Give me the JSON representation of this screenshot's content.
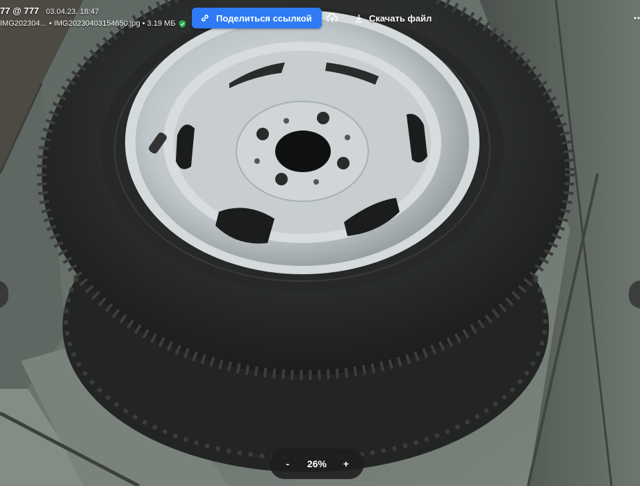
{
  "header": {
    "title": "77 @ 777",
    "date": "03.04.23, 18:47",
    "file_short": "IMG202304...",
    "file_full": "• IMG20230403154650.jpg • 3.19 МБ"
  },
  "toolbar": {
    "share_label": "Поделиться ссылкой",
    "download_label": "Скачать файл"
  },
  "zoom": {
    "minus_label": "-",
    "value": "26%",
    "plus_label": "+"
  },
  "colors": {
    "accent": "#2e7bf5",
    "rim": "#c5cbcd",
    "tire": "#2a2c2b",
    "wood": "#6f7871"
  },
  "icons": {
    "share": "link-icon",
    "upload": "cloud-upload-icon",
    "download": "download-icon",
    "verified": "shield-check-icon"
  }
}
